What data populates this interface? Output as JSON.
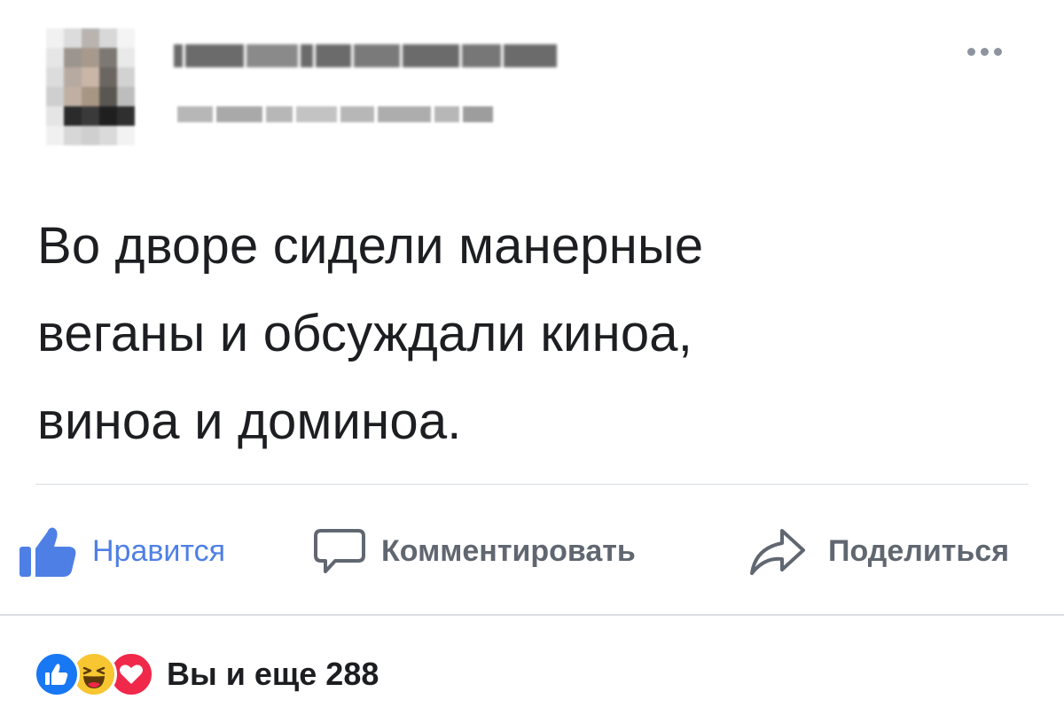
{
  "post": {
    "text_lines": [
      "Во дворе сидели манерные",
      "веганы и обсуждали киноа,",
      "виноа и доминоа."
    ]
  },
  "actions": {
    "like": {
      "label": "Нравится",
      "icon": "thumbs-up-icon",
      "color": "#4e7fe5"
    },
    "comment": {
      "label": "Комментировать",
      "icon": "comment-bubble-icon"
    },
    "share": {
      "label": "Поделиться",
      "icon": "share-arrow-icon"
    }
  },
  "reactions": {
    "icons": [
      "like-reaction-icon",
      "haha-reaction-icon",
      "love-reaction-icon"
    ],
    "summary": "Вы и еще 288"
  },
  "colors": {
    "like_blue": "#1877f2",
    "haha_yellow": "#f7c631",
    "love_red": "#f0284a",
    "muted_grey": "#606770"
  }
}
